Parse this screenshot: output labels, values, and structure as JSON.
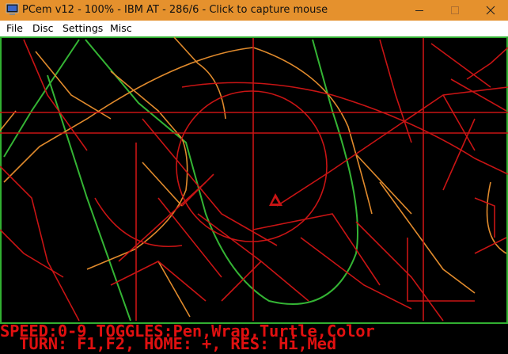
{
  "window": {
    "title": "PCem v12 - 100% - IBM AT - 286/6 - Click to capture mouse",
    "accent_color": "#e5912d",
    "controls": [
      "minimize-icon",
      "maximize-icon",
      "close-icon"
    ]
  },
  "menu": {
    "items": [
      "File",
      "Disc",
      "Settings",
      "Misc"
    ]
  },
  "screen": {
    "background": "#000000",
    "border_color": "#32b032",
    "line_colors": [
      "#c81414",
      "#e08a2c",
      "#34b434"
    ],
    "turtle_icon": "turtle-icon",
    "status_line1": "SPEED:0-9 TOGGLES:Pen,Wrap,Turtle,Color",
    "status_line2": "  TURN: F1,F2, HOME: +, RES: Hi,Med",
    "status_color": "#e01010"
  }
}
